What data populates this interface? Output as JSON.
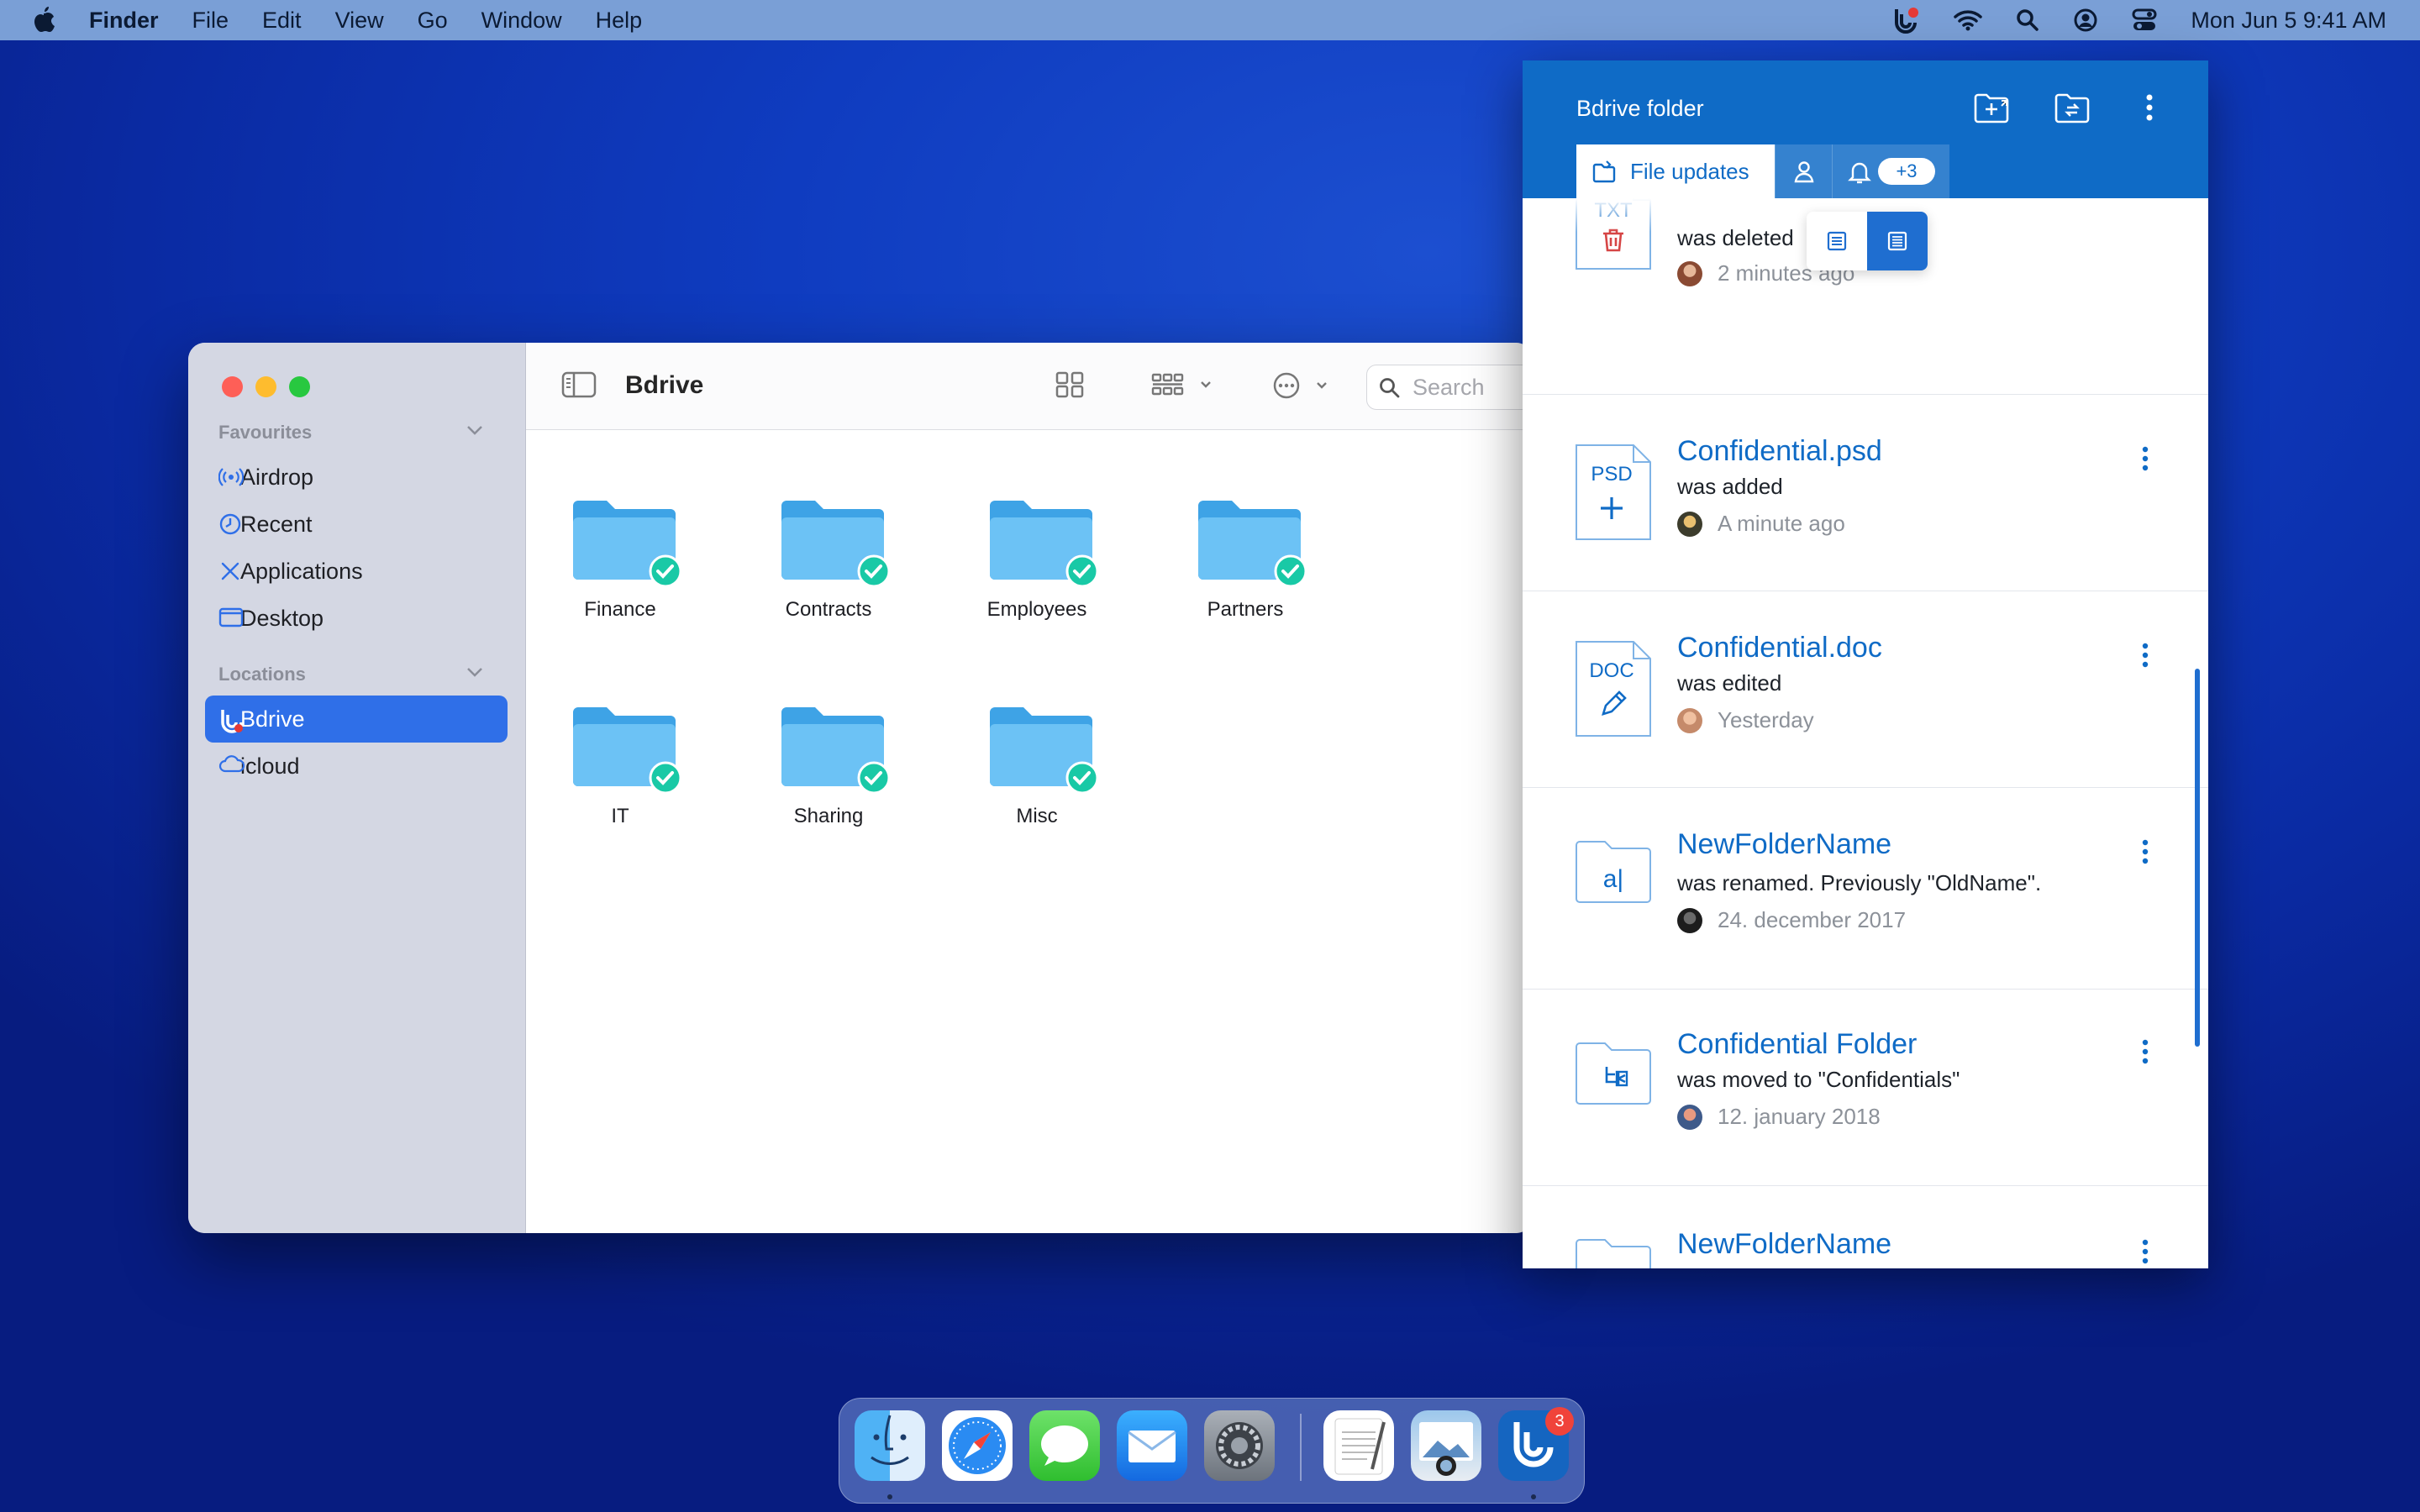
{
  "menubar": {
    "app": "Finder",
    "items": [
      "File",
      "Edit",
      "View",
      "Go",
      "Window",
      "Help"
    ],
    "clock": "Mon Jun 5  9:41 AM"
  },
  "finder": {
    "title": "Bdrive",
    "search_placeholder": "Search",
    "sidebar": {
      "favourites_title": "Favourites",
      "favourites": [
        "Airdrop",
        "Recent",
        "Applications",
        "Desktop"
      ],
      "locations_title": "Locations",
      "locations": [
        "Bdrive",
        "icloud"
      ]
    },
    "folders": [
      "Finance",
      "Contracts",
      "Employees",
      "Partners",
      "IT",
      "Sharing",
      "Misc"
    ]
  },
  "panel": {
    "title": "Bdrive folder",
    "tab_file_updates": "File updates",
    "notif_badge": "+3",
    "feed": [
      {
        "type": "TXT",
        "name": "",
        "action": "was deleted",
        "time": "2 minutes ago"
      },
      {
        "type": "PSD",
        "name": "Confidential.psd",
        "action": "was added",
        "time": "A minute ago"
      },
      {
        "type": "DOC",
        "name": "Confidential.doc",
        "action": "was edited",
        "time": "Yesterday"
      },
      {
        "type": "",
        "name": "NewFolderName",
        "action": "was renamed. Previously \"OldName\".",
        "time": "24. december 2017",
        "glyph": "a|"
      },
      {
        "type": "",
        "name": "Confidential Folder",
        "action": "was moved to \"Confidentials\"",
        "time": "12. january 2018"
      },
      {
        "type": "",
        "name": "NewFolderName",
        "action": "",
        "time": ""
      }
    ]
  },
  "dock": {
    "badge": "3"
  },
  "colors": {
    "accent": "#0f6bc6",
    "folder": "#5db8f0",
    "check": "#19c9a6",
    "desktop": "#0f3cc0"
  }
}
